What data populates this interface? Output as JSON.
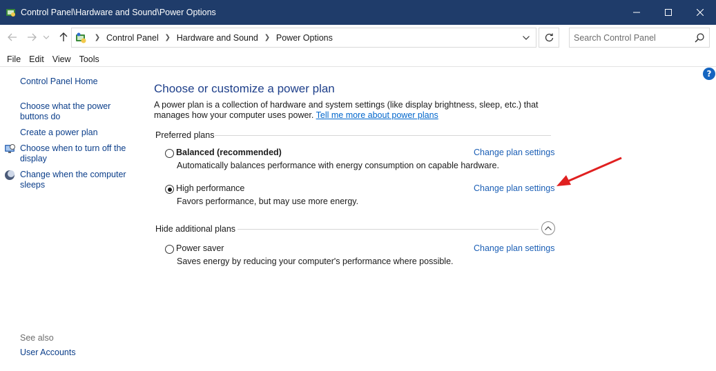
{
  "window": {
    "title": "Control Panel\\Hardware and Sound\\Power Options",
    "minimize_glyph": "—",
    "maximize_glyph": "☐",
    "close_glyph": "✕"
  },
  "address": {
    "crumbs": [
      "Control Panel",
      "Hardware and Sound",
      "Power Options"
    ],
    "search_placeholder": "Search Control Panel"
  },
  "menu": [
    "File",
    "Edit",
    "View",
    "Tools"
  ],
  "help_glyph": "?",
  "sidebar": {
    "home": "Control Panel Home",
    "links": [
      "Choose what the power buttons do",
      "Create a power plan",
      "Choose when to turn off the display",
      "Change when the computer sleeps"
    ],
    "see_also_label": "See also",
    "see_also_links": [
      "User Accounts"
    ]
  },
  "main": {
    "heading": "Choose or customize a power plan",
    "description": "A power plan is a collection of hardware and system settings (like display brightness, sleep, etc.) that manages how your computer uses power.",
    "learn_more_link": "Tell me more about power plans",
    "preferred_header": "Preferred plans",
    "hidden_header": "Hide additional plans",
    "plans": [
      {
        "name": "Balanced (recommended)",
        "description": "Automatically balances performance with energy consumption on capable hardware.",
        "link": "Change plan settings",
        "selected": false
      },
      {
        "name": "High performance",
        "description": "Favors performance, but may use more energy.",
        "link": "Change plan settings",
        "selected": true
      }
    ],
    "additional_plans": [
      {
        "name": "Power saver",
        "description": "Saves energy by reducing your computer's performance where possible.",
        "link": "Change plan settings",
        "selected": false
      }
    ]
  },
  "colors": {
    "titlebar": "#1f3c6a",
    "heading": "#1e3f8a",
    "link": "#1a5eb5",
    "annotation_arrow": "#e02020"
  },
  "icons": [
    "control-panel-icon",
    "back-arrow-icon",
    "forward-arrow-icon",
    "up-arrow-icon",
    "chevron-down-icon",
    "refresh-icon",
    "search-icon",
    "help-icon",
    "display-icon",
    "sleep-moon-icon",
    "collapse-chevron-up-icon"
  ]
}
